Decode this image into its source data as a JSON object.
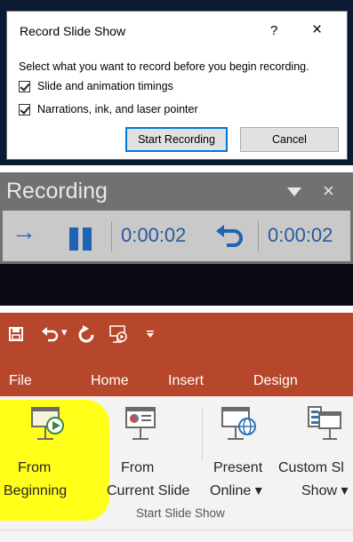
{
  "record_dialog": {
    "title": "Record Slide Show",
    "help": "?",
    "close": "×",
    "instruction": "Select what you want to record before you begin recording.",
    "options": [
      {
        "label": "Slide and animation timings",
        "checked": true
      },
      {
        "label": "Narrations, ink, and laser pointer",
        "checked": true
      }
    ],
    "start_button": "Start Recording",
    "cancel_button": "Cancel"
  },
  "recording_toolbar": {
    "title": "Recording",
    "close": "×",
    "next_icon": "→",
    "slide_time": "0:00:02",
    "total_time": "0:00:02",
    "icons": [
      "next-arrow-icon",
      "pause-icon",
      "repeat-icon",
      "dropdown-icon"
    ],
    "accent_color": "#1f63b5"
  },
  "ribbon": {
    "accent_color": "#b7472a",
    "highlight_color": "#ffff1a",
    "qat_icons": [
      "save-icon",
      "undo-icon",
      "redo-icon",
      "start-from-beginning-icon",
      "customize-qat-icon"
    ],
    "qat_more": "▾",
    "tabs": [
      "File",
      "Home",
      "Insert",
      "Design"
    ],
    "commands": [
      {
        "line1": "From",
        "line2": "Beginning"
      },
      {
        "line1": "From",
        "line2": "Current Slide"
      },
      {
        "line1": "Present",
        "line2": "Online ▾"
      },
      {
        "line1": "Custom Sl",
        "line2": "Show ▾"
      }
    ],
    "group_label": "Start Slide Show"
  }
}
